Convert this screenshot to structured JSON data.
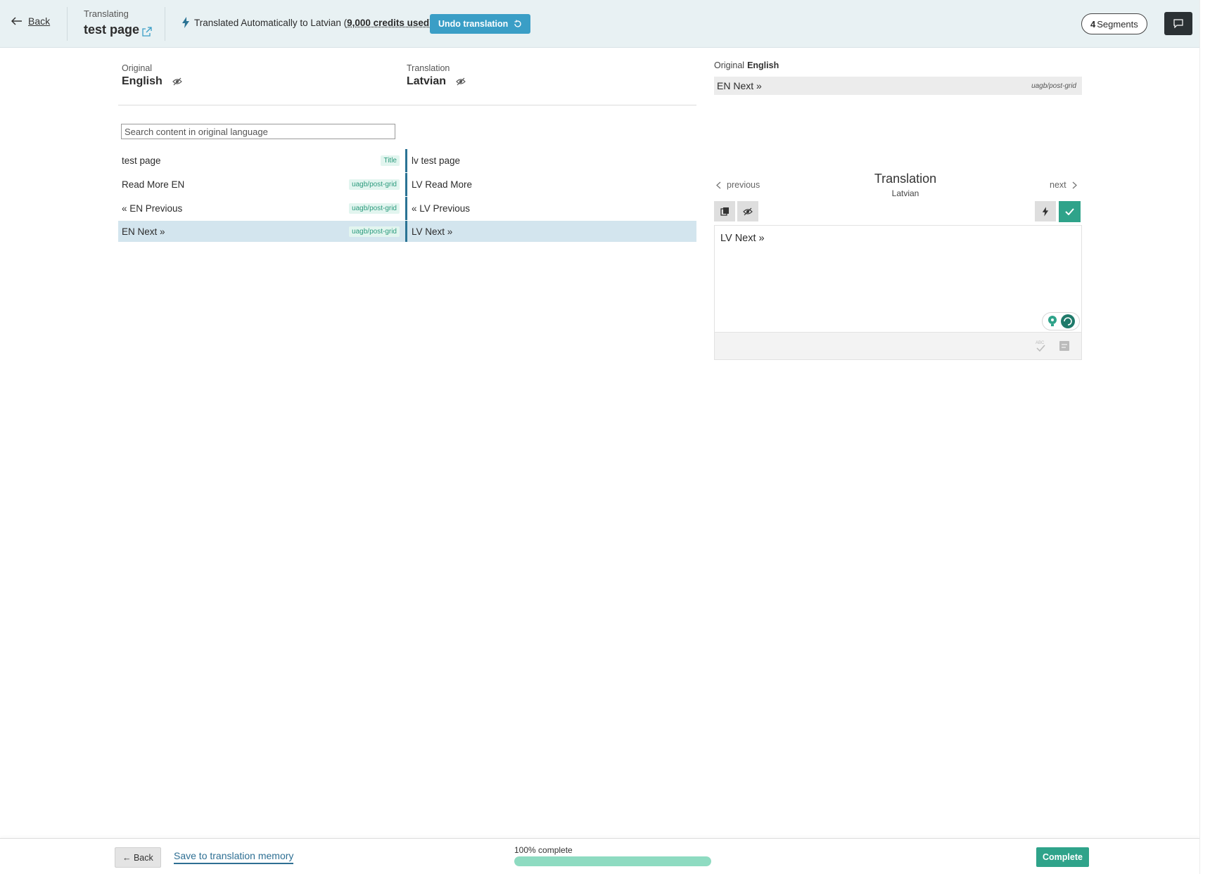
{
  "header": {
    "back_label": "Back",
    "translating_label": "Translating",
    "page_title": "test page",
    "auto_msg_prefix": "Translated Automatically to Latvian (",
    "credits_used": "9,000 credits used",
    "auto_msg_suffix": ")",
    "undo_label": "Undo translation",
    "segments_count": "4",
    "segments_label": "Segments"
  },
  "columns": {
    "original_label": "Original",
    "original_lang": "English",
    "translation_label": "Translation",
    "translation_lang": "Latvian"
  },
  "search": {
    "placeholder": "Search content in original language",
    "value": ""
  },
  "segments": [
    {
      "original": "test page",
      "tag": "Title",
      "translation": "lv test page"
    },
    {
      "original": "Read More EN",
      "tag": "uagb/post-grid",
      "translation": "LV Read More"
    },
    {
      "original": "« EN Previous",
      "tag": "uagb/post-grid",
      "translation": "« LV Previous"
    },
    {
      "original": "EN Next »",
      "tag": "uagb/post-grid",
      "translation": "LV Next »"
    }
  ],
  "panel": {
    "original_label": "Original",
    "original_lang": "English",
    "original_text": "EN Next »",
    "context": "uagb/post-grid",
    "prev_label": "previous",
    "next_label": "next",
    "title": "Translation",
    "subtitle": "Latvian",
    "editor_text": "LV Next »"
  },
  "footer": {
    "back_label": "← Back",
    "save_label": "Save to translation memory",
    "progress_label": "100% complete",
    "progress_fraction": 1.0,
    "complete_label": "Complete"
  },
  "colors": {
    "accent": "#3a9ec6",
    "success": "#2fa38a",
    "progress": "#8edbc1",
    "active_row": "#d3e5ee"
  }
}
